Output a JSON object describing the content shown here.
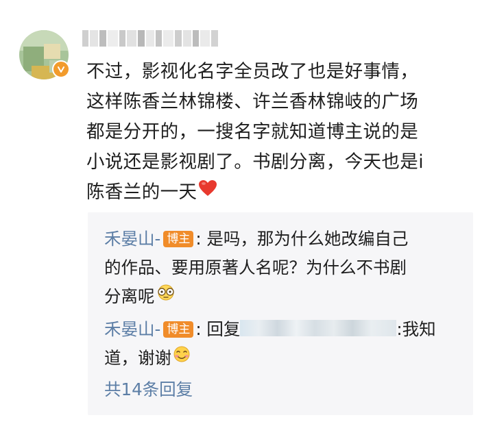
{
  "comment": {
    "lines": [
      "不过，影视化名字全员改了也是好事情，",
      "这样陈香兰林锦楼、许兰香林锦岐的广场",
      "都是分开的，一搜名字就知道博主说的是",
      "小说还是影视剧了。书剧分离，今天也是i",
      "陈香兰的一天"
    ],
    "end_icon": "red-heart-emoji"
  },
  "avatar": {
    "badge_icon": "verified-v-badge",
    "badge_color": "#f29b2c"
  },
  "replies": [
    {
      "author": "禾晏山-",
      "badge": "博主",
      "separator": ":",
      "lines": [
        " 是吗，那为什么她改编自己",
        "的作品、要用原著人名呢？为什么不书剧",
        "分离呢"
      ],
      "end_icon": "speechless-face-emoji"
    },
    {
      "author": "禾晏山-",
      "badge": "博主",
      "separator": ":",
      "prefix": " 回复",
      "suffix": ":我知",
      "line2": "道，谢谢",
      "end_icon": "smiling-face-emoji"
    }
  ],
  "more_replies_label": "共14条回复",
  "colors": {
    "link": "#5c7ea6",
    "badge": "#f08c2a",
    "reply_bg": "#f6f6f8"
  }
}
